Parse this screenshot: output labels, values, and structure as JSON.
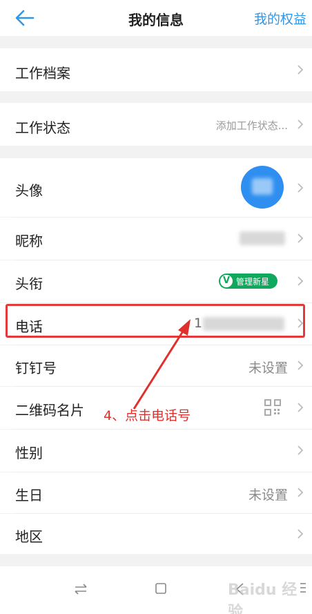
{
  "header": {
    "title": "我的信息",
    "right_action": "我的权益"
  },
  "rows": {
    "work_profile": {
      "label": "工作档案"
    },
    "work_status": {
      "label": "工作状态",
      "value": "添加工作状态..."
    },
    "avatar": {
      "label": "头像"
    },
    "nickname": {
      "label": "昵称"
    },
    "title": {
      "label": "头衔",
      "badge_letter": "V",
      "badge_text": "管理新星"
    },
    "phone": {
      "label": "电话",
      "value_visible_prefix": "1"
    },
    "dingtalk_id": {
      "label": "钉钉号",
      "value": "未设置"
    },
    "qr_card": {
      "label": "二维码名片"
    },
    "gender": {
      "label": "性别"
    },
    "birthday": {
      "label": "生日",
      "value": "未设置"
    },
    "region": {
      "label": "地区"
    }
  },
  "annotation": {
    "text": "4、点击电话号"
  },
  "colors": {
    "accent": "#3296e6",
    "highlight": "#e23a3a",
    "badge": "#10a85c"
  },
  "navbar": {
    "icons": [
      "swap-icon",
      "home-square-icon",
      "back-icon",
      "menu-icon"
    ]
  },
  "watermark": {
    "text": "Baidu 经验"
  }
}
